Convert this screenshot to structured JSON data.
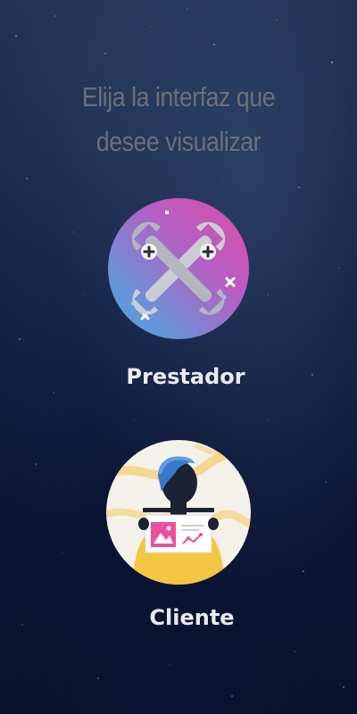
{
  "title": {
    "line1": "Elija la interfaz que",
    "line2": "desee visualizar"
  },
  "options": [
    {
      "label": "Prestador",
      "icon": "crossed-wrenches-icon"
    },
    {
      "label": "Cliente",
      "icon": "client-illustration-icon"
    }
  ],
  "colors": {
    "background": "#0f1d3d",
    "title": "#6d7079",
    "label": "#e9ebf0",
    "prestador_gradient_start": "#e04aa6",
    "prestador_gradient_end": "#4aa7d8",
    "cliente_accent": "#f4c542"
  }
}
